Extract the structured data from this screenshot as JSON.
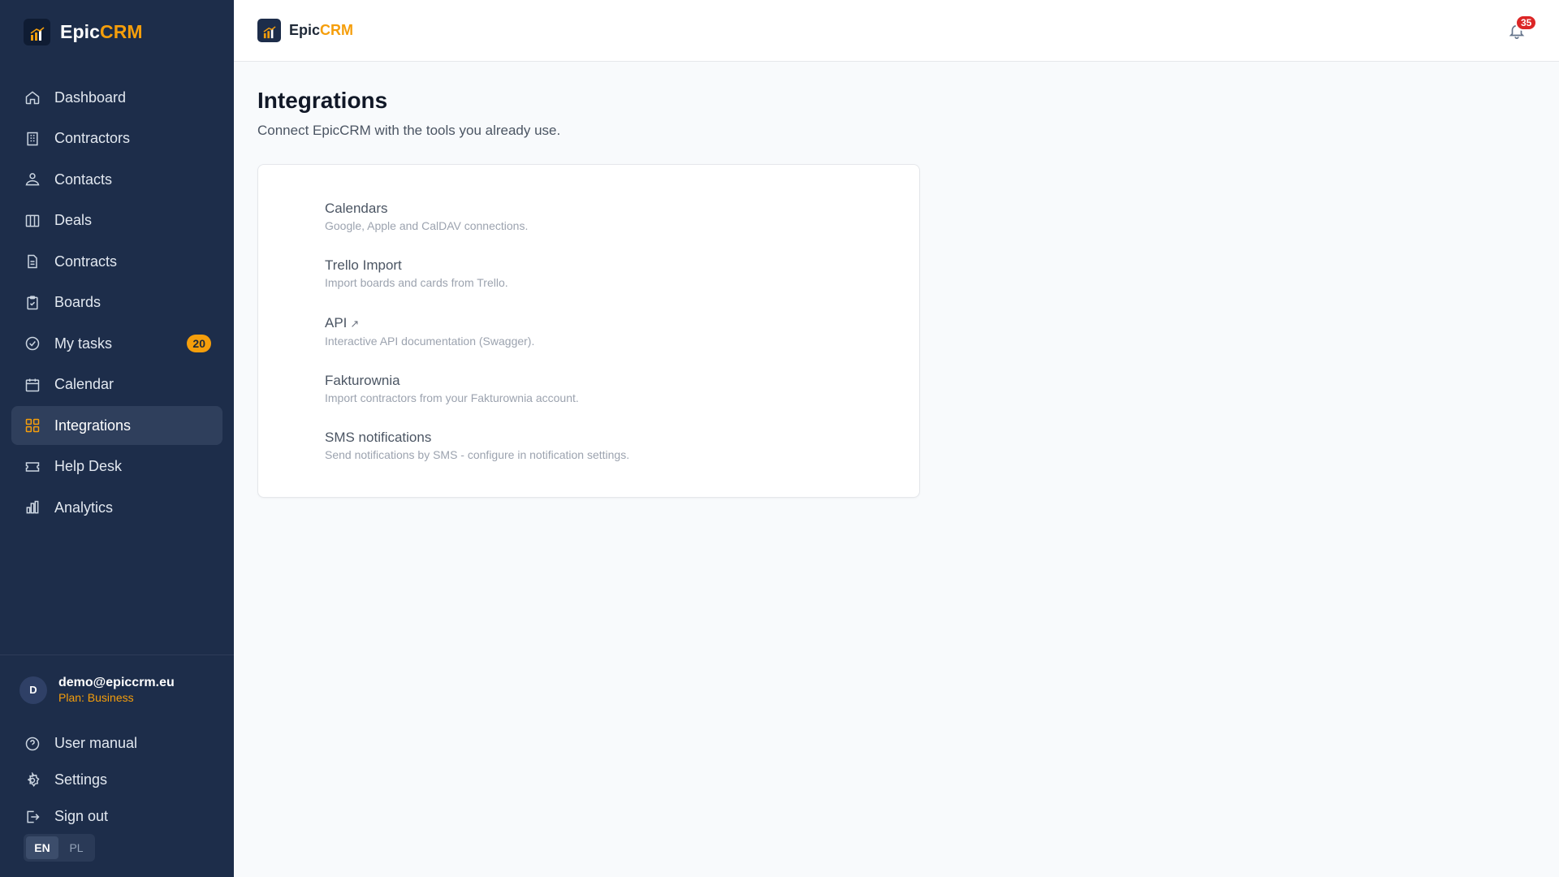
{
  "brand": {
    "name_prefix": "Epic",
    "name_suffix": "CRM"
  },
  "sidebar": {
    "items": [
      {
        "label": "Dashboard",
        "icon": "home-icon"
      },
      {
        "label": "Contractors",
        "icon": "building-icon"
      },
      {
        "label": "Contacts",
        "icon": "users-icon"
      },
      {
        "label": "Deals",
        "icon": "columns-icon"
      },
      {
        "label": "Contracts",
        "icon": "document-icon"
      },
      {
        "label": "Boards",
        "icon": "clipboard-icon"
      },
      {
        "label": "My tasks",
        "icon": "check-circle-icon",
        "badge": "20"
      },
      {
        "label": "Calendar",
        "icon": "calendar-icon"
      },
      {
        "label": "Integrations",
        "icon": "grid-icon",
        "active": true
      },
      {
        "label": "Help Desk",
        "icon": "ticket-icon"
      },
      {
        "label": "Analytics",
        "icon": "bar-chart-icon"
      }
    ],
    "user": {
      "avatar_initial": "D",
      "email": "demo@epiccrm.eu",
      "plan": "Plan: Business"
    },
    "footer_items": [
      {
        "label": "User manual",
        "icon": "help-circle-icon"
      },
      {
        "label": "Settings",
        "icon": "gear-icon"
      },
      {
        "label": "Sign out",
        "icon": "sign-out-icon"
      }
    ],
    "languages": [
      "EN",
      "PL"
    ],
    "active_language": "EN"
  },
  "topbar": {
    "notifications_count": "35"
  },
  "main": {
    "title": "Integrations",
    "subtitle": "Connect EpicCRM with the tools you already use.",
    "integrations": [
      {
        "title": "Calendars",
        "desc": "Google, Apple and CalDAV connections."
      },
      {
        "title": "Trello Import",
        "desc": "Import boards and cards from Trello."
      },
      {
        "title": "API",
        "external_mark": "↗",
        "desc": "Interactive API documentation (Swagger)."
      },
      {
        "title": "Fakturownia",
        "desc": "Import contractors from your Fakturownia account."
      },
      {
        "title": "SMS notifications",
        "desc": "Send notifications by SMS - configure in notification settings."
      }
    ]
  },
  "colors": {
    "sidebar_bg": "#1d2d4a",
    "accent": "#f59e0b",
    "badge_red": "#dc2626"
  }
}
